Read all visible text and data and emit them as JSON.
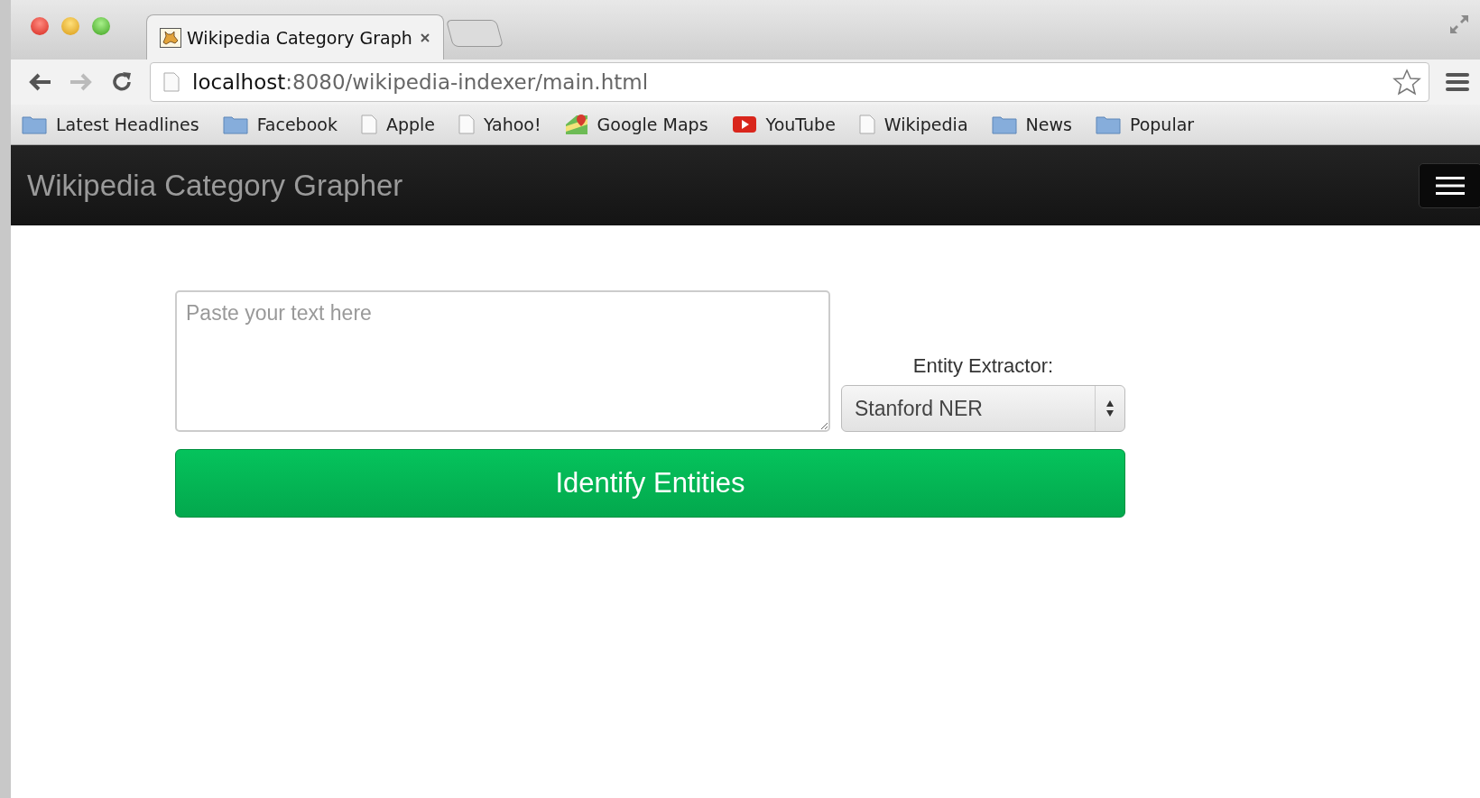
{
  "browser": {
    "tab": {
      "title": "Wikipedia Category Graph",
      "selected": true
    },
    "address": {
      "host": "localhost",
      "path": ":8080/wikipedia-indexer/main.html"
    },
    "bookmarks": [
      {
        "label": "Latest Headlines",
        "kind": "folder"
      },
      {
        "label": "Facebook",
        "kind": "folder"
      },
      {
        "label": "Apple",
        "kind": "page"
      },
      {
        "label": "Yahoo!",
        "kind": "page"
      },
      {
        "label": "Google Maps",
        "kind": "maps"
      },
      {
        "label": "YouTube",
        "kind": "video"
      },
      {
        "label": "Wikipedia",
        "kind": "page"
      },
      {
        "label": "News",
        "kind": "folder"
      },
      {
        "label": "Popular",
        "kind": "folder"
      }
    ]
  },
  "navbar": {
    "brand": "Wikipedia Category Grapher"
  },
  "form": {
    "text": {
      "placeholder": "Paste your text here"
    },
    "extractor_label": "Entity Extractor:",
    "extractor": {
      "value": "Stanford NER"
    },
    "submit": "Identify Entities"
  }
}
